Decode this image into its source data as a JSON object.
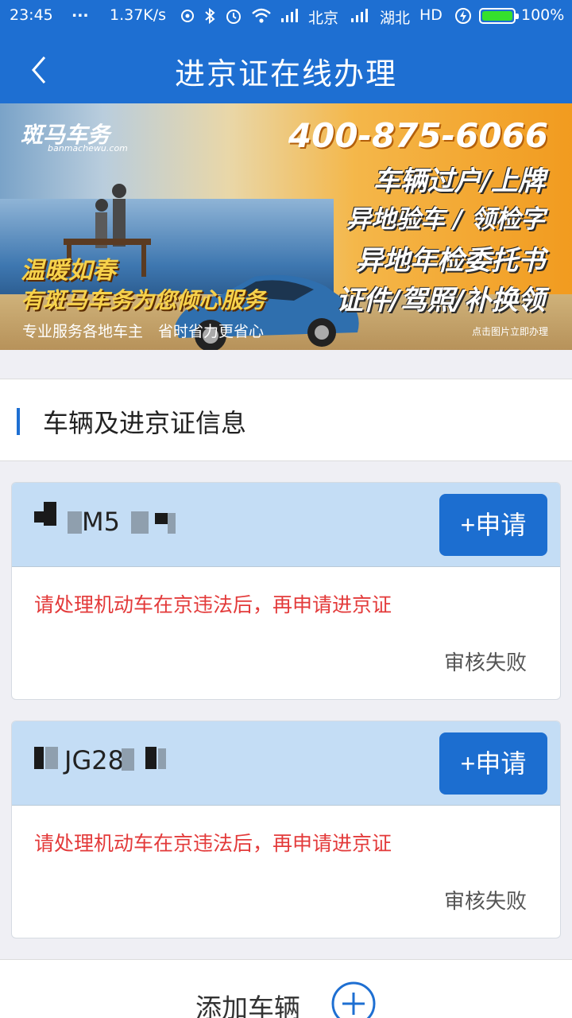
{
  "status_bar": {
    "time": "23:45",
    "dots": "...",
    "speed": "1.37K/s",
    "carrier1": "北京",
    "carrier2": "湖北",
    "hd": "HD",
    "battery": "100%"
  },
  "app_bar": {
    "title": "进京证在线办理"
  },
  "banner": {
    "logo": "斑马车务",
    "logo_url": "banmachewu.com",
    "phone": "400-875-6066",
    "services": [
      "车辆过户/上牌",
      "异地验车 / 领检字",
      "异地年检委托书",
      "证件/驾照/补换领"
    ],
    "slogan_line1": "温暖如春",
    "slogan_line2": "有斑马车务为您倾心服务",
    "footer_left": "专业服务各地车主　省时省力更省心",
    "footer_right": "点击图片立即办理"
  },
  "section": {
    "title": "车辆及进京证信息"
  },
  "vehicles": [
    {
      "plate_visible": "M5",
      "apply_label": "+申请",
      "message": "请处理机动车在京违法后，再申请进京证",
      "status": "审核失败"
    },
    {
      "plate_visible": "JG28",
      "apply_label": "+申请",
      "message": "请处理机动车在京违法后，再申请进京证",
      "status": "审核失败"
    }
  ],
  "footer": {
    "add_label": "添加车辆"
  },
  "colors": {
    "primary": "#1e6fd2",
    "card_header": "#c4ddf5",
    "error": "#e33a3a",
    "battery": "#35e02d"
  }
}
